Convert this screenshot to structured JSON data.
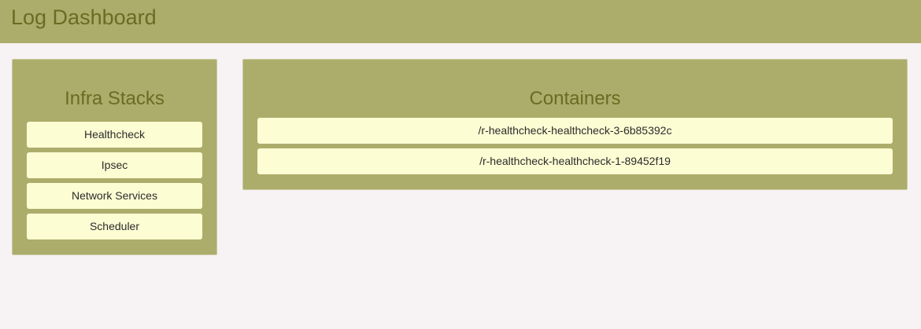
{
  "header": {
    "title": "Log Dashboard"
  },
  "stacks_panel": {
    "title": "Infra Stacks",
    "items": [
      {
        "label": "Healthcheck"
      },
      {
        "label": "Ipsec"
      },
      {
        "label": "Network Services"
      },
      {
        "label": "Scheduler"
      }
    ]
  },
  "containers_panel": {
    "title": "Containers",
    "items": [
      {
        "label": "/r-healthcheck-healthcheck-3-6b85392c"
      },
      {
        "label": "/r-healthcheck-healthcheck-1-89452f19"
      }
    ]
  },
  "colors": {
    "header_bg": "#acad6b",
    "panel_bg": "#acad6b",
    "title_text": "#6b6b22",
    "item_bg": "#fcfdd3",
    "page_bg": "#f7f2f3"
  }
}
